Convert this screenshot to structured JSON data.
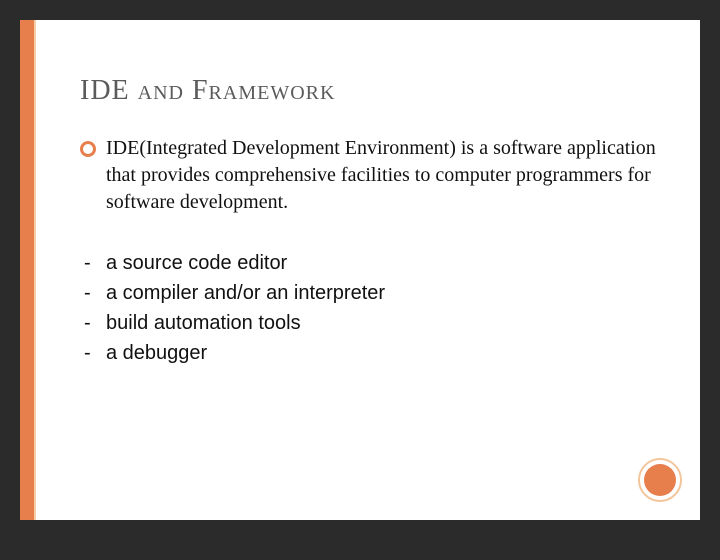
{
  "slide": {
    "title": "IDE and Framework",
    "main_bullet": "IDE(Integrated Development Environment) is a software application that provides comprehensive facilities to computer programmers for software development.",
    "sub_items": [
      "a source code editor",
      "a compiler and/or an interpreter",
      "build automation tools",
      "a debugger"
    ]
  }
}
